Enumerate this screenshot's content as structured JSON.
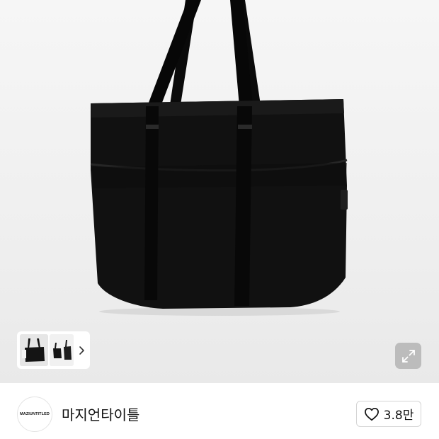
{
  "product": {
    "image_alt": "black tote bag",
    "image_icon": "tote-bag-photo"
  },
  "gallery": {
    "more_icon": "chevron-right-icon",
    "expand_icon": "expand-icon"
  },
  "shop": {
    "logo_text": "MAZIUNTITLED",
    "name": "마지언타이틀"
  },
  "like": {
    "icon": "heart-outline-icon",
    "count": "3.8만"
  },
  "colors": {
    "background": "#ffffff",
    "hero_background": "#efefef",
    "bag": "#0c0c0c",
    "text": "#111111",
    "border": "#d4d4d4"
  }
}
